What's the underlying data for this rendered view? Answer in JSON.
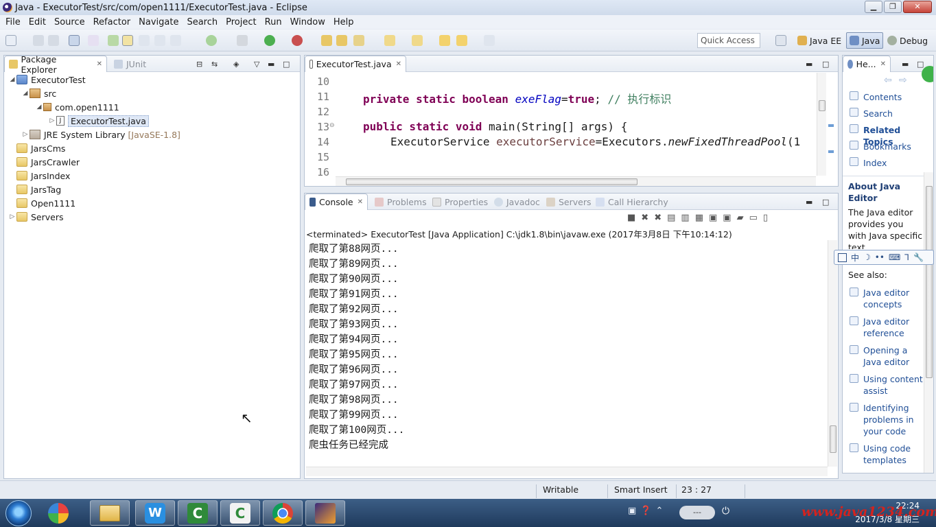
{
  "window": {
    "title": "Java - ExecutorTest/src/com/open1111/ExecutorTest.java - Eclipse",
    "minimize": "▁",
    "maximize": "❐",
    "close": "✕"
  },
  "menu": [
    "File",
    "Edit",
    "Source",
    "Refactor",
    "Navigate",
    "Search",
    "Project",
    "Run",
    "Window",
    "Help"
  ],
  "toolbar": {
    "quick_access_placeholder": "Quick Access",
    "perspectives": [
      {
        "label": "Java EE",
        "active": false
      },
      {
        "label": "Java",
        "active": true
      },
      {
        "label": "Debug",
        "active": false
      }
    ]
  },
  "package_explorer": {
    "tabs": [
      "Package Explorer",
      "JUnit"
    ],
    "tree": [
      {
        "label": "ExecutorTest",
        "level": 0,
        "expanded": true,
        "kind": "project"
      },
      {
        "label": "src",
        "level": 1,
        "expanded": true,
        "kind": "srcfolder"
      },
      {
        "label": "com.open1111",
        "level": 2,
        "expanded": true,
        "kind": "package"
      },
      {
        "label": "ExecutorTest.java",
        "level": 3,
        "expanded": false,
        "kind": "java",
        "selected": true
      },
      {
        "label": "JRE System Library",
        "suffix": "[JavaSE-1.8]",
        "level": 1,
        "expanded": false,
        "kind": "library"
      },
      {
        "label": "JarsCms",
        "level": 0,
        "kind": "folder"
      },
      {
        "label": "JarsCrawler",
        "level": 0,
        "kind": "folder"
      },
      {
        "label": "JarsIndex",
        "level": 0,
        "kind": "folder"
      },
      {
        "label": "JarsTag",
        "level": 0,
        "kind": "folder"
      },
      {
        "label": "Open1111",
        "level": 0,
        "kind": "folder"
      },
      {
        "label": "Servers",
        "level": 0,
        "expanded": false,
        "kind": "folder"
      }
    ]
  },
  "editor": {
    "tab": "ExecutorTest.java",
    "line_numbers": [
      "10",
      "11",
      "12",
      "13",
      "14",
      "15",
      "16"
    ],
    "line11": {
      "kw1": "private static boolean ",
      "field": "exeFlag",
      "eq": "=",
      "kw2": "true",
      "semi": "; ",
      "comment": "// 执行标识"
    },
    "line13": {
      "kw": "public static void ",
      "rest": "main(String[] args) {"
    },
    "line14": {
      "type": "ExecutorService ",
      "var": "executorService",
      "eq": "=Executors.",
      "call": "newFixedThreadPool",
      "tail": "(1"
    }
  },
  "console": {
    "tabs": [
      "Console",
      "Problems",
      "Properties",
      "Javadoc",
      "Servers",
      "Call Hierarchy"
    ],
    "header": "<terminated> ExecutorTest [Java Application] C:\\jdk1.8\\bin\\javaw.exe (2017年3月8日 下午10:14:12)",
    "lines": [
      "爬取了第88网页...",
      "爬取了第89网页...",
      "爬取了第90网页...",
      "爬取了第91网页...",
      "爬取了第92网页...",
      "爬取了第93网页...",
      "爬取了第94网页...",
      "爬取了第95网页...",
      "爬取了第96网页...",
      "爬取了第97网页...",
      "爬取了第98网页...",
      "爬取了第99网页...",
      "爬取了第100网页...",
      "爬虫任务已经完成"
    ]
  },
  "help": {
    "tab": "He...",
    "links": [
      "Contents",
      "Search",
      "Related Topics",
      "Bookmarks",
      "Index"
    ],
    "about_title": "About Java Editor",
    "about_text": "The Java editor provides you with Java specific text",
    "see_also": "See also:",
    "see_links": [
      "Java editor concepts",
      "Java editor reference",
      "Opening a Java editor",
      "Using content assist",
      "Identifying problems in your code",
      "Using code templates"
    ]
  },
  "ime_bar": {
    "items": [
      "中",
      "☽",
      "••",
      "⌨",
      "⅂",
      "🔧"
    ]
  },
  "statusbar": {
    "writable": "Writable",
    "insert_mode": "Smart Insert",
    "position": "23 : 27"
  },
  "taskbar": {
    "clock_time": "22:24",
    "clock_date": "2017/3/8 星期三",
    "watermark": "www.java1234.com",
    "apps": [
      "start",
      "color-app",
      "explorer",
      "writer",
      "camtasia",
      "camtasia-recorder",
      "chrome",
      "eclipse"
    ]
  }
}
